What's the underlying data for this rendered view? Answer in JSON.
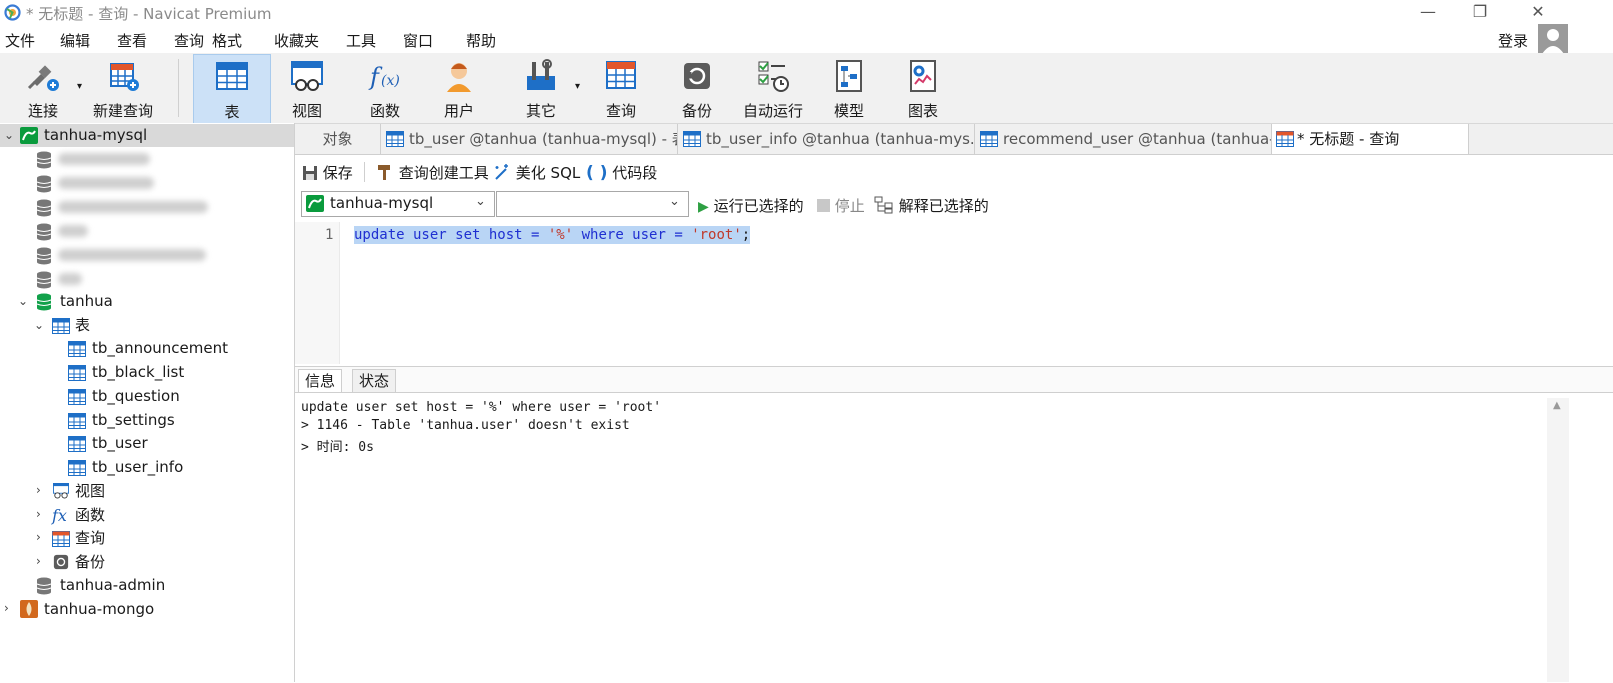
{
  "window": {
    "title": "* 无标题 - 查询 - Navicat Premium",
    "minimize": "—",
    "restore": "❐",
    "close": "✕"
  },
  "menu": [
    "文件",
    "编辑",
    "查看",
    "查询",
    "格式",
    "收藏夹",
    "工具",
    "窗口",
    "帮助"
  ],
  "login": "登录",
  "toolbar": {
    "connect": "连接",
    "new_query": "新建查询",
    "table": "表",
    "view": "视图",
    "function": "函数",
    "user": "用户",
    "other": "其它",
    "query": "查询",
    "backup": "备份",
    "auto_run": "自动运行",
    "model": "模型",
    "chart": "图表"
  },
  "tree": {
    "connection": "tanhua-mysql",
    "db_tanhua": "tanhua",
    "tables_node": "表",
    "tables": [
      "tb_announcement",
      "tb_black_list",
      "tb_question",
      "tb_settings",
      "tb_user",
      "tb_user_info"
    ],
    "views_node": "视图",
    "functions_node": "函数",
    "queries_node": "查询",
    "backups_node": "备份",
    "db_admin": "tanhua-admin",
    "mongo": "tanhua-mongo"
  },
  "tabs": {
    "objects": "对象",
    "t1": "tb_user @tanhua (tanhua-mysql) - 表",
    "t2": "tb_user_info @tanhua (tanhua-mys...",
    "t3": "recommend_user @tanhua (tanhua-...",
    "t4": "* 无标题 - 查询"
  },
  "query_toolbar": {
    "save": "保存",
    "builder": "查询创建工具",
    "beautify": "美化 SQL",
    "snippet": "代码段",
    "connection_value": "tanhua-mysql",
    "database_value": "",
    "run_selected": "运行已选择的",
    "stop": "停止",
    "explain": "解释已选择的"
  },
  "editor": {
    "line_no": "1",
    "sql_kw1": "update user set host = ",
    "sql_str1": "'%'",
    "sql_kw2": " where user = ",
    "sql_str2": "'root'",
    "sql_end": ";"
  },
  "result": {
    "tab_info": "信息",
    "tab_status": "状态",
    "line1": "update user set host = '%' where user = 'root'",
    "line2": "> 1146 - Table 'tanhua.user' doesn't exist",
    "line3": "> 时间: 0s"
  },
  "colors": {
    "accent": "#0a9b3d",
    "keyword": "#1f2fd1",
    "string": "#c0392b",
    "selection": "#b9d5f5"
  }
}
